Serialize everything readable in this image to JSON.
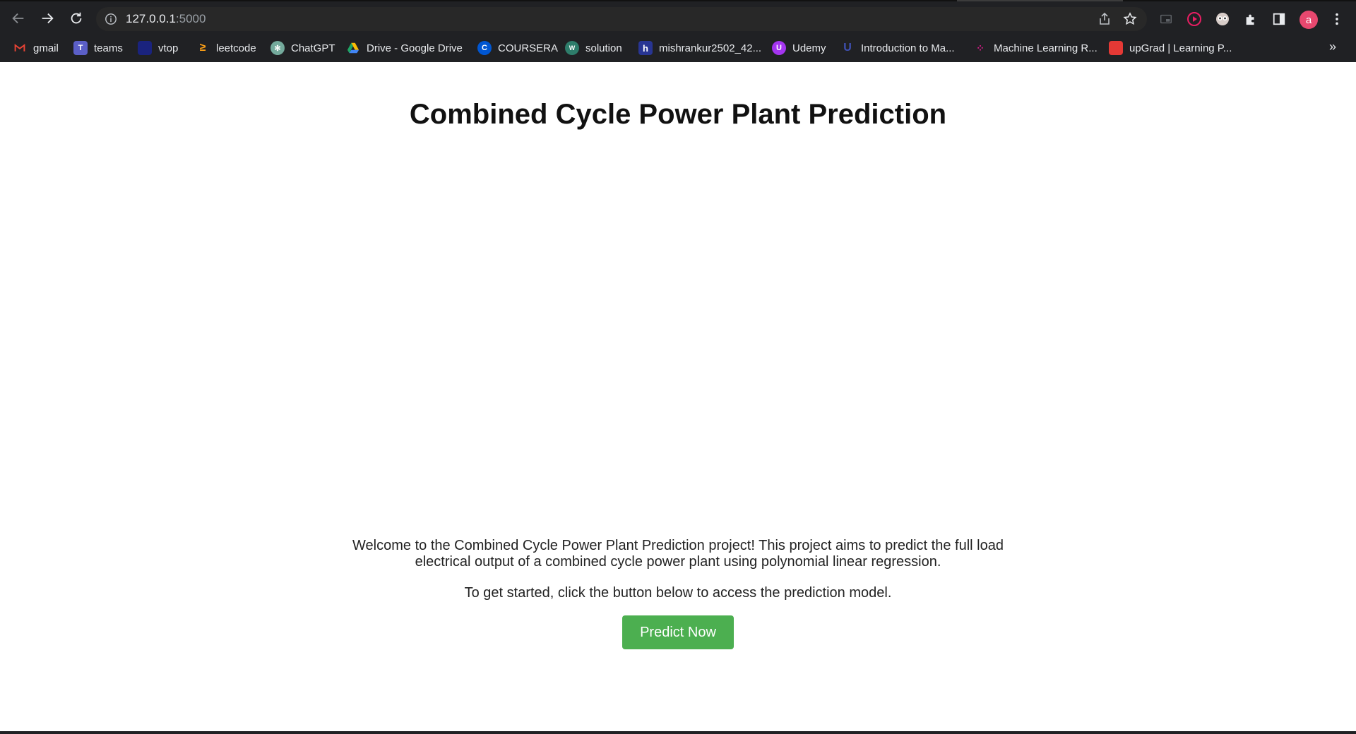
{
  "browser": {
    "url_host": "127.0.0.1",
    "url_port": ":5000",
    "avatar_letter": "a",
    "more_bookmarks": "»"
  },
  "bookmarks": [
    {
      "label": "gmail",
      "icon": "gmail-icon",
      "color": "#ea4335"
    },
    {
      "label": "teams",
      "icon": "teams-icon",
      "color": "#5b5fc7"
    },
    {
      "label": "vtop",
      "icon": "vtop-icon",
      "color": "#1a237e"
    },
    {
      "label": "leetcode",
      "icon": "leetcode-icon",
      "color": "#ffa116"
    },
    {
      "label": "ChatGPT",
      "icon": "chatgpt-icon",
      "color": "#74aa9c"
    },
    {
      "label": "Drive - Google Drive",
      "icon": "drive-icon",
      "color": "#fbbc04"
    },
    {
      "label": "COURSERA",
      "icon": "coursera-icon",
      "color": "#0056d2"
    },
    {
      "label": "solution",
      "icon": "solution-icon",
      "color": "#2e7d6b"
    },
    {
      "label": "mishrankur2502_42...",
      "icon": "hackerrank-icon",
      "color": "#283593"
    },
    {
      "label": "Udemy",
      "icon": "udemy-icon",
      "color": "#a435f0"
    },
    {
      "label": "Introduction to Ma...",
      "icon": "udacity-icon",
      "color": "#3f51b5"
    },
    {
      "label": "Machine Learning R...",
      "icon": "ml-icon",
      "color": "#d81b8a"
    },
    {
      "label": "upGrad | Learning P...",
      "icon": "upgrad-icon",
      "color": "#e53935"
    }
  ],
  "page": {
    "title": "Combined Cycle Power Plant Prediction",
    "intro": "Welcome to the Combined Cycle Power Plant Prediction project! This project aims to predict the full load electrical output of a combined cycle power plant using polynomial linear regression.",
    "cta": "To get started, click the button below to access the prediction model.",
    "button": "Predict Now"
  },
  "colors": {
    "chrome": "#202124",
    "button": "#4caf50",
    "avatar": "#e8486f"
  }
}
